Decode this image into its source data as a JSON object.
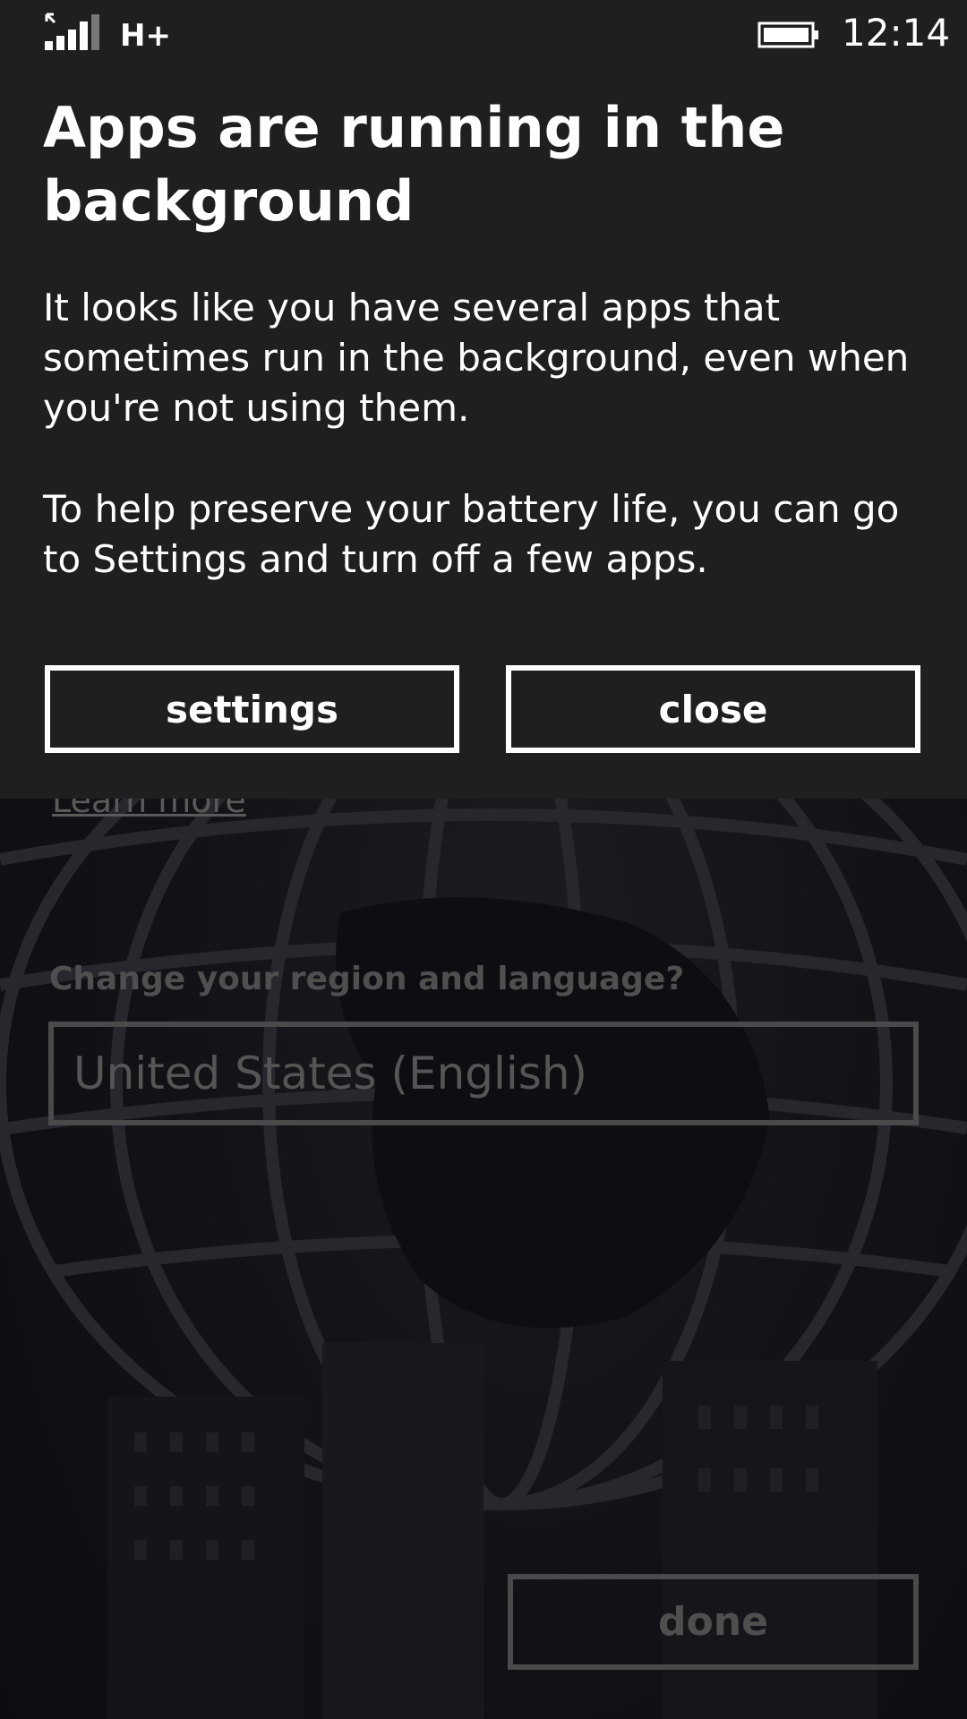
{
  "status_bar": {
    "signal_icon": "signal-bars-icon",
    "network_type": "H+",
    "battery_icon": "battery-icon",
    "time": "12:14"
  },
  "dialog": {
    "title": "Apps are running in the background",
    "body_paragraph_1": "It looks like you have several apps that sometimes run in the background, even when you're not using them.",
    "body_paragraph_2": "To help preserve your battery life, you can go to Settings and turn off a few apps.",
    "buttons": {
      "settings_label": "settings",
      "close_label": "close"
    }
  },
  "background_page": {
    "learn_more_link": "Learn more",
    "region_label": "Change your region and language?",
    "region_value": "United States (English)",
    "done_label": "done"
  },
  "colors": {
    "dialog_background": "#1f1f1f",
    "foreground": "#ffffff",
    "dimmed_text": "#555555"
  }
}
